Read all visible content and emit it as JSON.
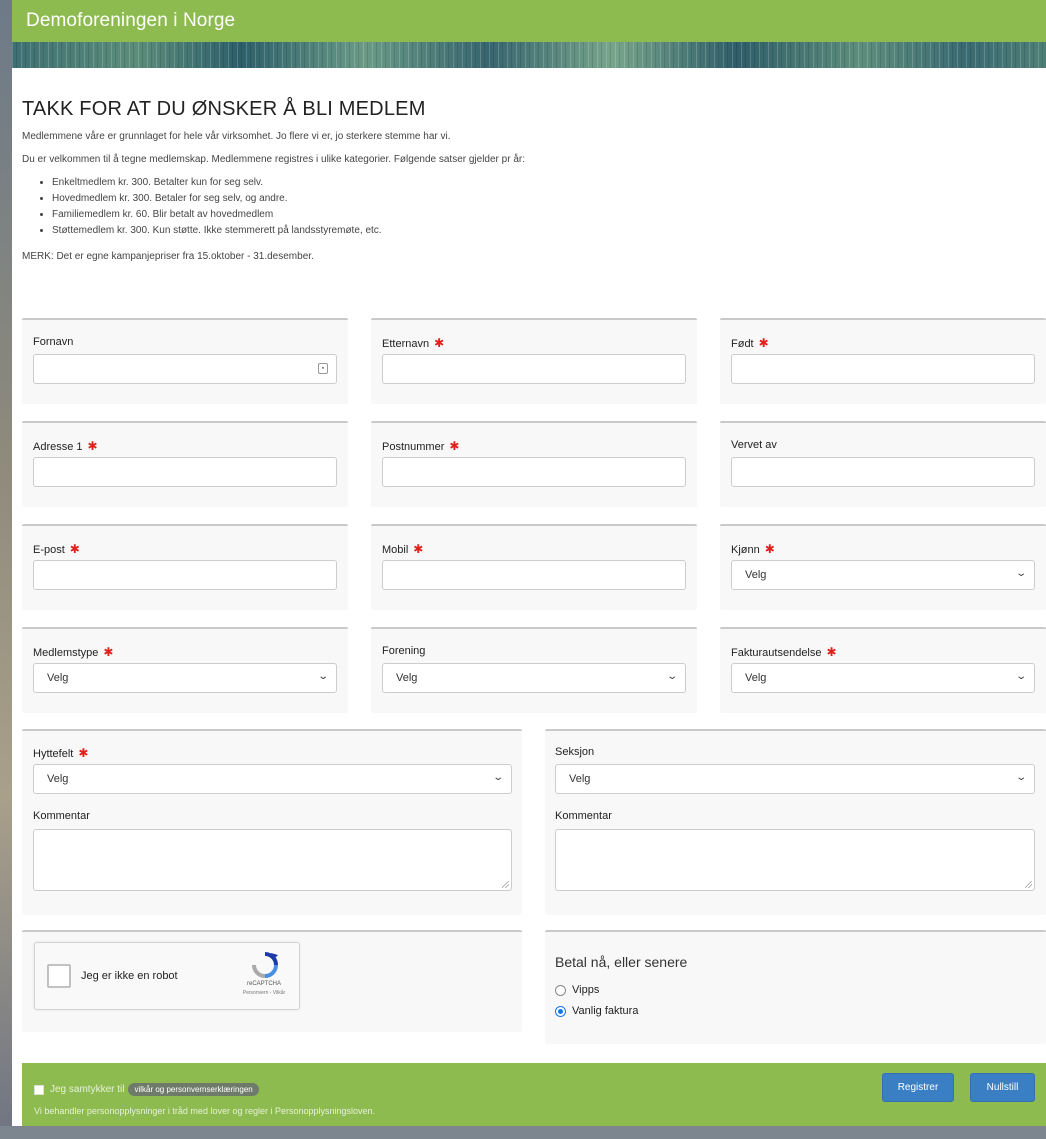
{
  "header": {
    "site_title": "Demoforeningen i Norge"
  },
  "intro": {
    "heading": "TAKK FOR AT DU ØNSKER Å BLI MEDLEM",
    "para1": "Medlemmene våre er grunnlaget for hele vår virksomhet. Jo flere vi er, jo sterkere stemme har vi.",
    "para2": "Du er velkommen til å tegne medlemskap. Medlemmene registres i ulike kategorier. Følgende satser gjelder pr år:",
    "bullets": [
      "Enkeltmedlem kr. 300. Betalter kun for seg selv.",
      "Hovedmedlem kr. 300. Betaler for seg selv, og andre.",
      "Familiemedlem kr. 60. Blir betalt av hovedmedlem",
      "Støttemedlem kr. 300. Kun støtte. Ikke stemmerett på landsstyremøte, etc."
    ],
    "note": "MERK: Det er egne kampanjepriser fra 15.oktober - 31.desember."
  },
  "required_marker": "✱",
  "fields": {
    "fornavn": {
      "label": "Fornavn",
      "value": ""
    },
    "etternavn": {
      "label": "Etternavn",
      "value": ""
    },
    "fodt": {
      "label": "Født",
      "value": ""
    },
    "adresse1": {
      "label": "Adresse 1",
      "value": ""
    },
    "postnummer": {
      "label": "Postnummer",
      "value": ""
    },
    "vervet_av": {
      "label": "Vervet av",
      "value": ""
    },
    "epost": {
      "label": "E-post",
      "value": ""
    },
    "mobil": {
      "label": "Mobil",
      "value": ""
    },
    "kjonn": {
      "label": "Kjønn",
      "selected": "Velg"
    },
    "medlemstype": {
      "label": "Medlemstype",
      "selected": "Velg"
    },
    "forening": {
      "label": "Forening",
      "selected": "Velg"
    },
    "fakturautsendelse": {
      "label": "Fakturautsendelse",
      "selected": "Velg"
    },
    "hyttefelt": {
      "label": "Hyttefelt",
      "selected": "Velg"
    },
    "kommentar_left": {
      "label": "Kommentar",
      "value": ""
    },
    "seksjon": {
      "label": "Seksjon",
      "selected": "Velg"
    },
    "kommentar_right": {
      "label": "Kommentar",
      "value": ""
    }
  },
  "captcha": {
    "label": "Jeg er ikke en robot",
    "brand": "reCAPTCHA",
    "terms": "Personvern - Vilkår"
  },
  "payment": {
    "title": "Betal nå, eller senere",
    "options": [
      {
        "label": "Vipps",
        "checked": false
      },
      {
        "label": "Vanlig faktura",
        "checked": true
      }
    ]
  },
  "footer": {
    "consent_prefix": "Jeg samtykker til",
    "consent_link": "vilkår og personvernserklæringen",
    "legal": "Vi behandler personopplysninger i tråd med lover og regler i Personopplysningsloven.",
    "register_label": "Registrer",
    "reset_label": "Nullstill"
  },
  "colors": {
    "brand_green": "#8dbb4f",
    "button_blue": "#3a7fc4",
    "required_red": "#e0201b",
    "radio_blue": "#1a73e8"
  }
}
